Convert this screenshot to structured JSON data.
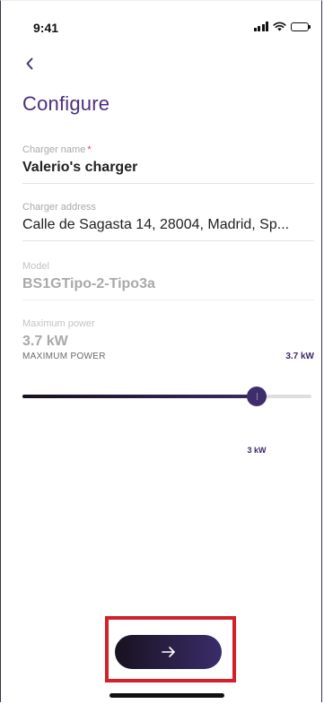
{
  "status_bar": {
    "time": "9:41",
    "signal_icon": "cellular-signal-icon",
    "wifi_icon": "wifi-icon",
    "battery_icon": "battery-icon"
  },
  "header": {
    "back_icon": "chevron-left-icon",
    "title": "Configure"
  },
  "form": {
    "charger_name": {
      "label": "Charger name",
      "required_mark": "*",
      "value": "Valerio's charger"
    },
    "charger_address": {
      "label": "Charger address",
      "value": "Calle de Sagasta 14, 28004, Madrid, Sp..."
    },
    "model": {
      "label": "Model",
      "value": "BS1GTipo-2-Tipo3a"
    },
    "maximum_power": {
      "label": "Maximum power",
      "value": "3.7 kW"
    }
  },
  "power_slider": {
    "label": "MAXIMUM POWER",
    "max_label": "3.7 kW",
    "current_label": "3 kW",
    "min_value": 0,
    "max_value": 3.7,
    "current_value": 3.0
  },
  "footer": {
    "next_icon": "arrow-right-icon"
  },
  "colors": {
    "accent": "#4b2f7e",
    "button": "#2a1f45",
    "highlight": "#d3202a",
    "required": "#e0436a"
  }
}
